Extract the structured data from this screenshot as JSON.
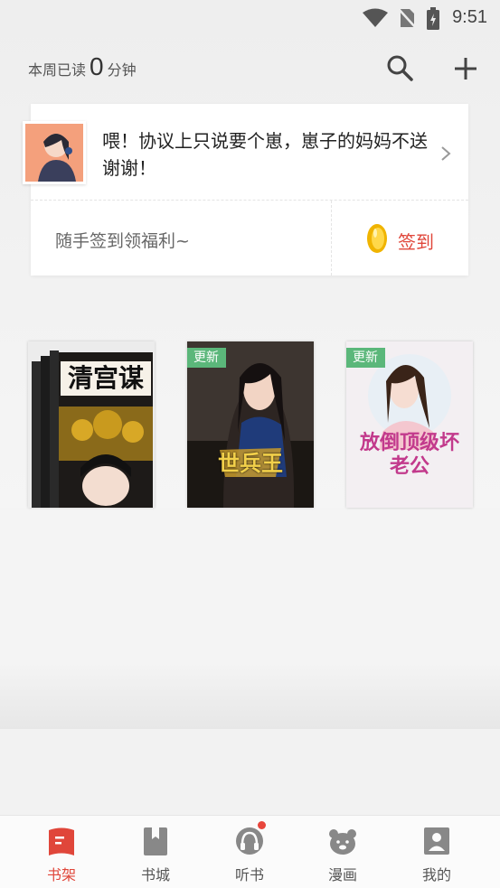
{
  "status_bar": {
    "time": "9:51"
  },
  "header": {
    "read_prefix": "本周已读",
    "read_count": "0",
    "read_suffix": "分钟"
  },
  "sign_card": {
    "message": "喂！协议上只说要个崽，崽子的妈妈不送谢谢！",
    "welfare_text": "随手签到领福利~",
    "signin_label": "签到"
  },
  "books": [
    {
      "cover_title": "清宫谋",
      "tag": "",
      "bg": "#1f1f1f"
    },
    {
      "cover_title": "世兵王",
      "tag": "更新",
      "bg": "#1a1612"
    },
    {
      "cover_title": "放倒顶级坏老公",
      "tag": "更新",
      "bg": "#f1eef3"
    }
  ],
  "tabbar": {
    "items": [
      {
        "label": "书架",
        "icon": "bookshelf-icon",
        "active": true
      },
      {
        "label": "书城",
        "icon": "bookstore-icon",
        "active": false
      },
      {
        "label": "听书",
        "icon": "headphones-icon",
        "active": false,
        "badge": true
      },
      {
        "label": "漫画",
        "icon": "comic-bear-icon",
        "active": false
      },
      {
        "label": "我的",
        "icon": "profile-icon",
        "active": false
      }
    ]
  },
  "colors": {
    "accent": "#e0463a",
    "update_tag": "#5bb77a"
  }
}
